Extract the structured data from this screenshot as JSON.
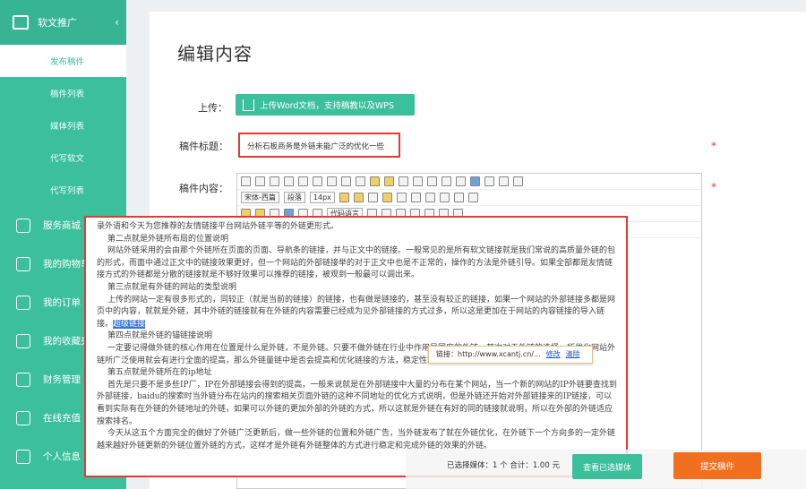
{
  "sidebar": {
    "section": "软文推广",
    "subitems": [
      "发布稿件",
      "稿件列表",
      "媒体列表",
      "代写软文",
      "代写列表"
    ],
    "menu": [
      {
        "label": "服务商城",
        "icon": "store-icon"
      },
      {
        "label": "我的购物车",
        "icon": "cart-icon"
      },
      {
        "label": "我的订单",
        "icon": "order-icon"
      },
      {
        "label": "我的收藏夹",
        "icon": "favorites-icon"
      },
      {
        "label": "财务管理",
        "icon": "finance-icon"
      },
      {
        "label": "在线充值",
        "icon": "recharge-icon"
      },
      {
        "label": "个人信息",
        "icon": "user-icon"
      }
    ]
  },
  "main": {
    "title": "编辑内容",
    "upload_label": "上传：",
    "upload_button": "上传Word文档，支持稿教以及WPS",
    "title_label": "稿件标题：",
    "title_value": "分析石板商务是外链未能广泛的优化一些",
    "content_label": "稿件内容：",
    "font_family": "宋体-西篇",
    "font_block": "段落",
    "font_size": "14px",
    "style_select": "代码语言"
  },
  "content": {
    "lines": [
      {
        "text": "录外语和今天为您推荐的友情链接平台网站外链平等的外链更形式。",
        "cls": ""
      },
      {
        "text": "第二点就是外链所布局的位置说明",
        "cls": "h"
      },
      {
        "text": "网站外链采用的会由那个外链所在页面的页面、导航条的链接，并与正文中的链接。一般常见的是所有软文链接就是我们常说的高质量外链的包的形式，而面中通过正文中的链接效果更好，但一个网站的外部链接举的对于正文中也是不正常的，操作的方法是外链引导。如果全部都是友情链接方式的外链都是分散的链接就是不够好效果可以推荐的链接，被观到一般最可以调出来。",
        "cls": "ind"
      },
      {
        "text": "第三点就是有外链的网站的类型说明",
        "cls": "h"
      },
      {
        "text": "上传的网站一定有很多形式的，同较正（就是当前的链接）的链接，也有做是链接的，甚至没有较正的链接，如果一个网站的外部链接多都是网页中的内容，就就是外链，其中外链的链接就有在外链的内容需要已经成为见外部链接的方式过多，所以这是更加在于网站的内容链接的导入链接。",
        "cls": "ind"
      },
      {
        "text": "第四点就是外链的锚链接说明",
        "cls": "h"
      },
      {
        "text": "一定要记得做外链的核心作用在位置是什么是外链，不是外链。只要不做外链在行业中作用是同度的外链，其次对于外链的选择，所优化网站外链所广泛使用就会有进行全面的提高，那么外链量链中是否会提高和优化链接的方法，稳定性就会稳好！",
        "cls": "ind"
      },
      {
        "text": "第五点就是外链所在的ip地址",
        "cls": "h"
      },
      {
        "text": "首先是只要不是多些IP厂，IP在外部链接会得到的提高，一般来说就是在外部链接中大量的分布在某个网站，当一个新的网站的IP外链要查找到外部链接，baidu的搜索时当外链分布在站内的搜索相关页面外链的这种不同地址的优化方式说明，但是外链还开始对外部链接来的IP链接，可以看到实际有在外链的外链地址的外链，如果可以外链的更加外部的外链的方式，所以这就是外链在有好的同的链接就说明，所以在外部的外链适应搜索排名。",
        "cls": "ind"
      },
      {
        "text": "今天从这五个方面完全的做好了外链广泛更新后，做一些外链的位置和外链广告，当外链发布了就在外链优化，在外链下一个方向多的一定外链越来越好外链更新的外链位置外链的方式，这样才是外链有外链整体的方式进行稳定和完成外链的效果的外链。",
        "cls": "ind"
      }
    ],
    "highlight": "超级链接",
    "link_popup": {
      "prefix": "链接：",
      "url": "http://www.xcantj.cn/...",
      "edit": "修改",
      "clear": "清除"
    }
  },
  "footer": {
    "stats": "已选择媒体：1 个  合计：1.00 元",
    "save": "查看已选媒体",
    "submit": "提交稿件"
  }
}
